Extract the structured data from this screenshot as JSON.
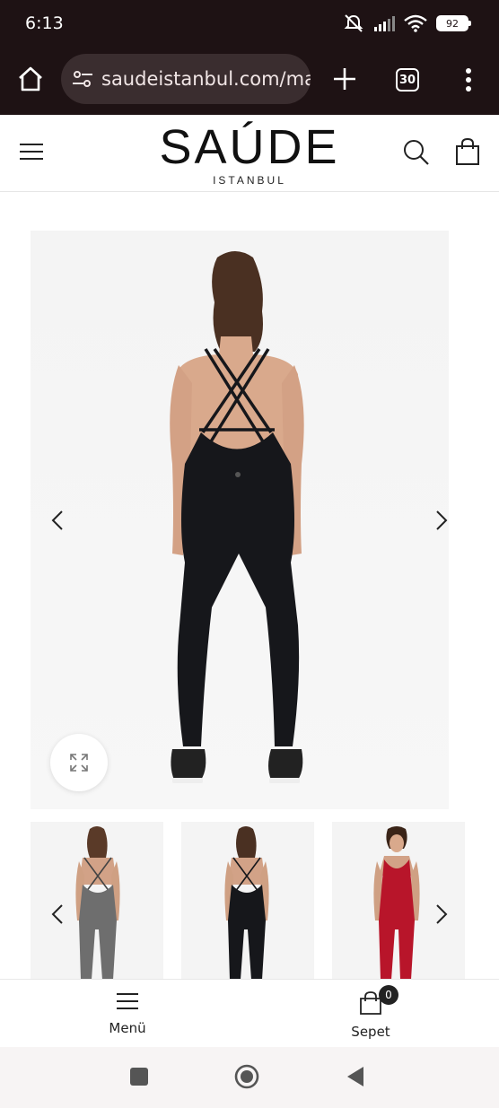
{
  "status_bar": {
    "time": "6:13",
    "battery": "92"
  },
  "browser": {
    "url": "saudeistanbul.com/ma",
    "tab_count": "30"
  },
  "header": {
    "logo_main": "SAÚDE",
    "logo_sub": "ISTANBUL"
  },
  "gallery": {
    "main_image_alt": "black jumpsuit back view",
    "thumbnails": [
      "grey jumpsuit back",
      "black jumpsuit back",
      "red jumpsuit front"
    ]
  },
  "bottom_nav": {
    "menu_label": "Menü",
    "cart_label": "Sepet",
    "cart_count": "0"
  },
  "colors": {
    "chrome": "#1e1214",
    "jumpsuit_black": "#16171b",
    "jumpsuit_red": "#b8152a",
    "jumpsuit_grey": "#6e6e6e"
  },
  "icons": [
    "home-icon",
    "tune-icon",
    "plus-icon",
    "more-vert-icon",
    "hamburger-icon",
    "search-icon",
    "bag-icon",
    "chevron-left-icon",
    "chevron-right-icon",
    "expand-icon",
    "stop-icon",
    "home-circle-icon",
    "back-icon"
  ]
}
